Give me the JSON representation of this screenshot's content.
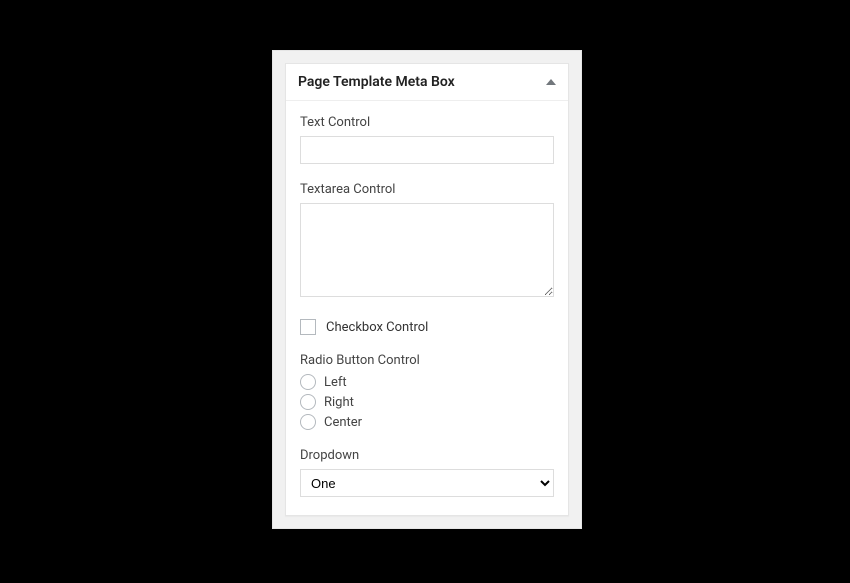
{
  "metabox": {
    "title": "Page Template Meta Box",
    "fields": {
      "text": {
        "label": "Text Control",
        "value": ""
      },
      "textarea": {
        "label": "Textarea Control",
        "value": ""
      },
      "checkbox": {
        "label": "Checkbox Control",
        "checked": false
      },
      "radio": {
        "label": "Radio Button Control",
        "options": [
          "Left",
          "Right",
          "Center"
        ],
        "selected": null
      },
      "dropdown": {
        "label": "Dropdown",
        "selected": "One"
      }
    }
  }
}
